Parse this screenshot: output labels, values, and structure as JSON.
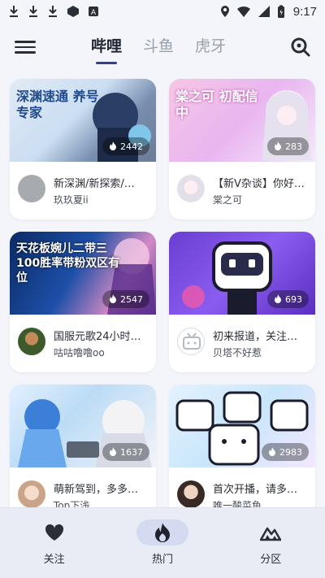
{
  "status_bar": {
    "time": "9:17"
  },
  "header": {
    "tabs": [
      {
        "label": "哔哩",
        "active": true
      },
      {
        "label": "斗鱼",
        "active": false
      },
      {
        "label": "虎牙",
        "active": false
      }
    ]
  },
  "cards": [
    {
      "title": "新深渊/新探索/…",
      "streamer": "玖玖夏ii",
      "viewers": "2442",
      "thumb_text": "深渊速通 养号专家"
    },
    {
      "title": "【新V杂谈】你好…",
      "streamer": "棠之可",
      "viewers": "283",
      "thumb_text": "棠之可 初配信中"
    },
    {
      "title": "国服元歌24小时…",
      "streamer": "咕咕噜噜oo",
      "viewers": "2547",
      "thumb_text": "天花板婉儿二带三 100胜率带粉双区有位"
    },
    {
      "title": "初来报道，关注…",
      "streamer": "贝塔不好惹",
      "viewers": "693",
      "thumb_text": ""
    },
    {
      "title": "萌新驾到，多多…",
      "streamer": "Top下浅",
      "viewers": "1637",
      "thumb_text": ""
    },
    {
      "title": "首次开播，请多…",
      "streamer": "唯一酸菜鱼",
      "viewers": "2983",
      "thumb_text": ""
    }
  ],
  "bottom_nav": [
    {
      "label": "关注",
      "icon": "heart-icon",
      "active": false
    },
    {
      "label": "热门",
      "icon": "flame-icon",
      "active": true
    },
    {
      "label": "分区",
      "icon": "mountain-icon",
      "active": false
    }
  ],
  "colors": {
    "accent": "#3a3f7a",
    "background": "#f3f5fa",
    "nav_active": "#d4dbf0"
  }
}
